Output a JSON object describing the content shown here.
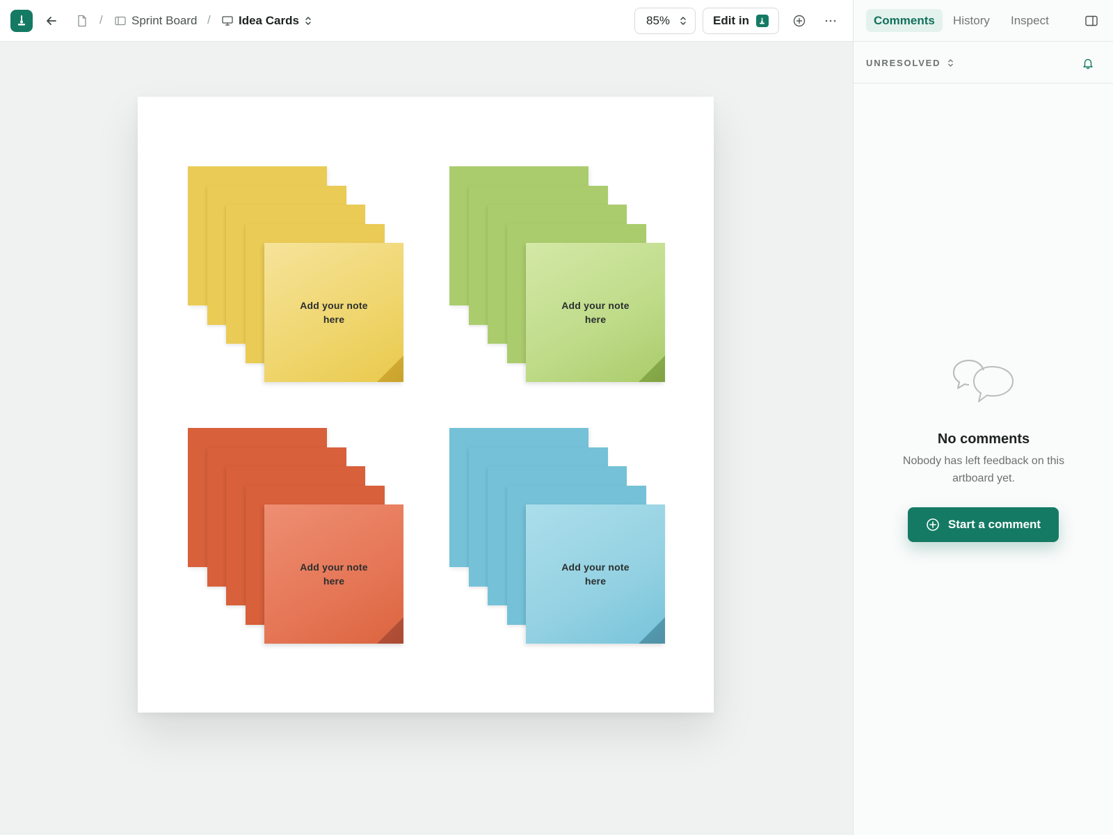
{
  "topbar": {
    "breadcrumb": {
      "project": "Sprint Board",
      "artboard": "Idea Cards"
    },
    "zoom": "85%",
    "edit_label": "Edit in"
  },
  "artboard": {
    "notes": [
      {
        "text": "Add your note here",
        "color": "yellow"
      },
      {
        "text": "Add your note here",
        "color": "green"
      },
      {
        "text": "Add your note here",
        "color": "red"
      },
      {
        "text": "Add your note here",
        "color": "blue"
      }
    ]
  },
  "panel": {
    "tabs": [
      "Comments",
      "History",
      "Inspect"
    ],
    "active_tab": "Comments",
    "filter": "UNRESOLVED",
    "empty_title": "No comments",
    "empty_description": "Nobody has left feedback on this artboard yet.",
    "start_button": "Start a comment"
  },
  "colors": {
    "accent": "#157a64",
    "yellow_back": "#eacb55",
    "yellow_front": "#f4df8e",
    "green_back": "#abcc6d",
    "green_front": "#cee4a0",
    "red_back": "#d8603b",
    "red_front": "#ec8a6c",
    "blue_back": "#74c1d8",
    "blue_front": "#a6dbe8"
  }
}
